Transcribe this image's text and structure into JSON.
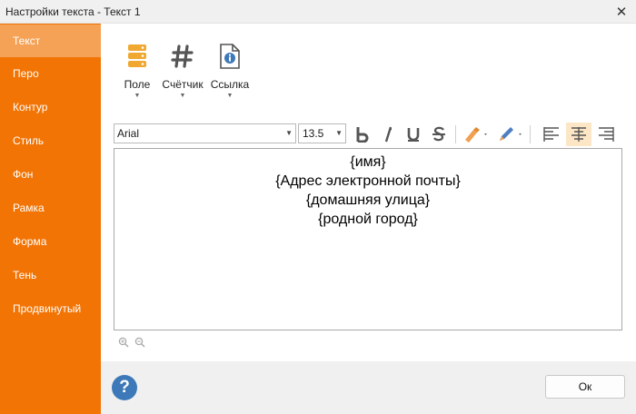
{
  "window": {
    "title": "Настройки текста - Текст 1",
    "close_glyph": "✕"
  },
  "sidebar": {
    "active_index": 0,
    "items": [
      {
        "label": "Текст"
      },
      {
        "label": "Перо"
      },
      {
        "label": "Контур"
      },
      {
        "label": "Стиль"
      },
      {
        "label": "Фон"
      },
      {
        "label": "Рамка"
      },
      {
        "label": "Форма"
      },
      {
        "label": "Тень"
      },
      {
        "label": "Продвинутый"
      }
    ]
  },
  "toolbar": {
    "field": {
      "label": "Поле",
      "icon": "database-icon"
    },
    "counter": {
      "label": "Счётчик",
      "icon": "hash-icon"
    },
    "link": {
      "label": "Ссылка",
      "icon": "document-info-icon"
    }
  },
  "format": {
    "font": "Arial",
    "size": "13.5",
    "bold": false,
    "italic": false,
    "underline": false,
    "strikethrough": false,
    "alignment": "center"
  },
  "editor": {
    "lines": [
      "{имя}",
      "{Адрес электронной почты}",
      "{домашняя улица}",
      "{родной город}"
    ]
  },
  "footer": {
    "help_glyph": "?",
    "ok_label": "Ок"
  },
  "colors": {
    "sidebar_bg": "#f27405",
    "sidebar_active": "#f5a257",
    "accent_icon": "#f0a830",
    "help_blue": "#3d78b8",
    "highlight_marker": "#f0a050",
    "pen_color": "#4d7fc4"
  }
}
